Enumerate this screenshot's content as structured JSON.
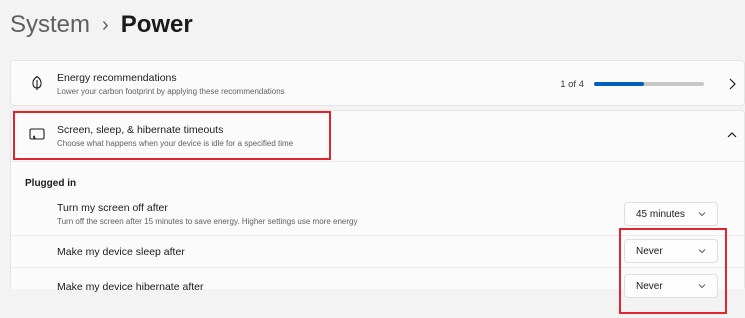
{
  "breadcrumb": {
    "parent": "System",
    "separator": "›",
    "current": "Power"
  },
  "energy": {
    "title": "Energy recommendations",
    "subtitle": "Lower your carbon footprint by applying these recommendations",
    "progress_text": "1 of 4",
    "progress_value": 0.45,
    "icon": "leaf-icon",
    "action_icon": "chevron-right-icon"
  },
  "timeouts": {
    "title": "Screen, sleep, & hibernate timeouts",
    "subtitle": "Choose what happens when your device is idle for a specified time",
    "icon": "screen-sleep-icon",
    "toggle_icon": "chevron-up-icon",
    "section_label": "Plugged in",
    "rows": [
      {
        "title": "Turn my screen off after",
        "subtitle": "Turn off the screen after 15 minutes to save energy. Higher settings use more energy",
        "value": "45 minutes"
      },
      {
        "title": "Make my device sleep after",
        "value": "Never"
      },
      {
        "title": "Make my device hibernate after",
        "value": "Never"
      }
    ]
  },
  "colors": {
    "accent": "#005fb8",
    "highlight_box": "#e0262c",
    "background": "#f3f3f3"
  }
}
